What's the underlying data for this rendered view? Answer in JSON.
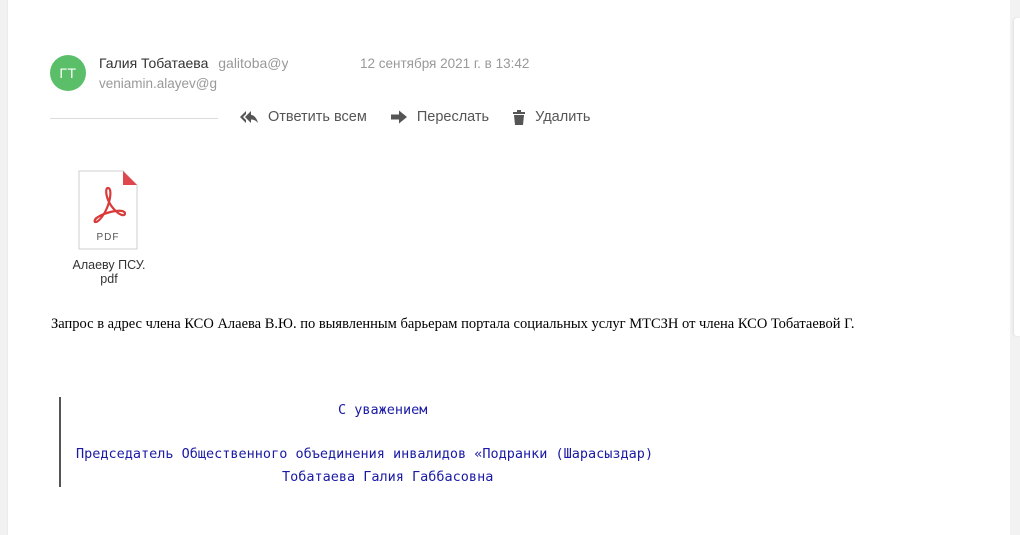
{
  "sender": {
    "avatar_initials": "ГТ",
    "avatar_color": "#5bbf6a",
    "name": "Галия Тобатаева",
    "email": "galitoba@y",
    "recipient": "veniamin.alayev@g",
    "date": "12 сентября 2021 г. в 13:42"
  },
  "actions": {
    "reply_all": "Ответить всем",
    "forward": "Переслать",
    "delete": "Удалить"
  },
  "attachment": {
    "type_label": "PDF",
    "name_line1": "Алаеву ПСУ.",
    "name_line2": "pdf"
  },
  "body": {
    "text": "Запрос в адрес члена КСО Алаева В.Ю. по выявленным барьерам портала социальных услуг МТСЗН от члена КСО Тобатаевой Г."
  },
  "signature": {
    "greeting": "С уважением",
    "title": "Председатель Общественного объединения инвалидов «Подранки (Шарасыздар)",
    "name": "Тобатаева Галия Габбасовна",
    "color": "#1a1aa6"
  }
}
